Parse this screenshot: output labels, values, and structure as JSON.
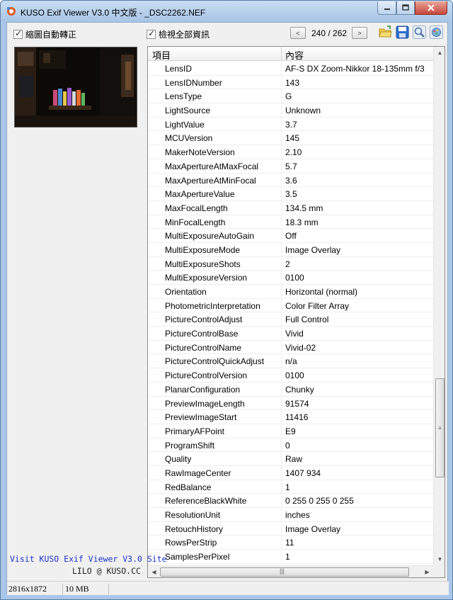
{
  "window": {
    "title": "KUSO Exif Viewer V3.0 中文版 - _DSC2262.NEF"
  },
  "toolbar": {
    "rotate_label": "縮圖自動轉正",
    "show_all_label": "檢視全部資訊",
    "prev_symbol": "<",
    "next_symbol": ">",
    "counter": "240 / 262"
  },
  "grid": {
    "col_name": "項目",
    "col_value": "內容",
    "rows": [
      [
        "LensID",
        "AF-S DX Zoom-Nikkor 18-135mm f/3"
      ],
      [
        "LensIDNumber",
        "143"
      ],
      [
        "LensType",
        "G"
      ],
      [
        "LightSource",
        "Unknown"
      ],
      [
        "LightValue",
        "3.7"
      ],
      [
        "MCUVersion",
        "145"
      ],
      [
        "MakerNoteVersion",
        "2.10"
      ],
      [
        "MaxApertureAtMaxFocal",
        "5.7"
      ],
      [
        "MaxApertureAtMinFocal",
        "3.6"
      ],
      [
        "MaxApertureValue",
        "3.5"
      ],
      [
        "MaxFocalLength",
        "134.5 mm"
      ],
      [
        "MinFocalLength",
        "18.3 mm"
      ],
      [
        "MultiExposureAutoGain",
        "Off"
      ],
      [
        "MultiExposureMode",
        "Image Overlay"
      ],
      [
        "MultiExposureShots",
        "2"
      ],
      [
        "MultiExposureVersion",
        "0100"
      ],
      [
        "Orientation",
        "Horizontal (normal)"
      ],
      [
        "PhotometricInterpretation",
        "Color Filter Array"
      ],
      [
        "PictureControlAdjust",
        "Full Control"
      ],
      [
        "PictureControlBase",
        "Vivid"
      ],
      [
        "PictureControlName",
        "Vivid-02"
      ],
      [
        "PictureControlQuickAdjust",
        "n/a"
      ],
      [
        "PictureControlVersion",
        "0100"
      ],
      [
        "PlanarConfiguration",
        "Chunky"
      ],
      [
        "PreviewImageLength",
        "91574"
      ],
      [
        "PreviewImageStart",
        "11416"
      ],
      [
        "PrimaryAFPoint",
        "E9"
      ],
      [
        "ProgramShift",
        "0"
      ],
      [
        "Quality",
        "Raw"
      ],
      [
        "RawImageCenter",
        "1407 934"
      ],
      [
        "RedBalance",
        "1"
      ],
      [
        "ReferenceBlackWhite",
        "0 255 0 255 0 255"
      ],
      [
        "ResolutionUnit",
        "inches"
      ],
      [
        "RetouchHistory",
        "Image Overlay"
      ],
      [
        "RowsPerStrip",
        "11"
      ],
      [
        "SamplesPerPixel",
        "1"
      ]
    ]
  },
  "left_panel": {
    "site_link": "Visit KUSO Exif Viewer V3.0 Site",
    "credit": "LILO @ KUSO.CC"
  },
  "status": {
    "dimensions": "2816x1872",
    "size": "10 MB"
  },
  "icons": {
    "app": "kuso-app-icon",
    "open": "folder-open-icon",
    "save": "save-icon",
    "zoom": "magnifier-icon",
    "settings": "settings-icon"
  },
  "colors": {
    "titlebar": "#b9d3ef",
    "link": "#1a33c8",
    "close_button": "#c6463a"
  }
}
